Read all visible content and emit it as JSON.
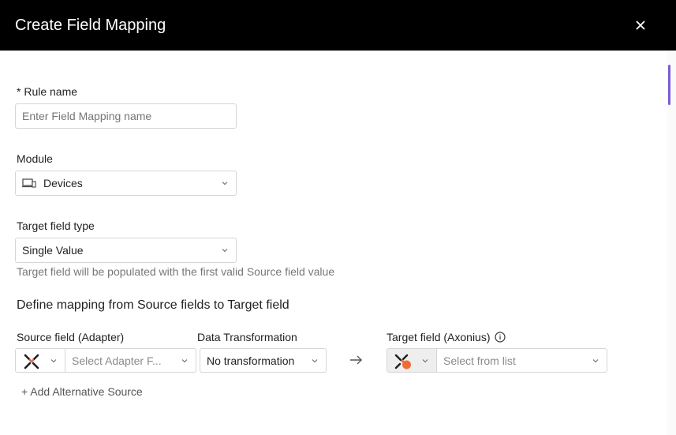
{
  "dialog": {
    "title": "Create Field Mapping"
  },
  "rule_name": {
    "label": "* Rule name",
    "placeholder": "Enter Field Mapping name"
  },
  "module": {
    "label": "Module",
    "value": "Devices",
    "icon": "device-icon"
  },
  "target_field_type": {
    "label": "Target field type",
    "value": "Single Value",
    "hint": "Target field will be populated with the first valid Source field value"
  },
  "mapping": {
    "title": "Define mapping from Source fields to Target field",
    "source_label": "Source field (Adapter)",
    "source_placeholder": "Select Adapter F...",
    "transformation_label": "Data Transformation",
    "transformation_value": "No transformation",
    "target_label": "Target field (Axonius)",
    "target_placeholder": "Select from list",
    "add_alternative": "+ Add Alternative Source"
  },
  "colors": {
    "header_bg": "#000000",
    "accent": "#7b5cd6",
    "brand_orange": "#f06c35"
  }
}
